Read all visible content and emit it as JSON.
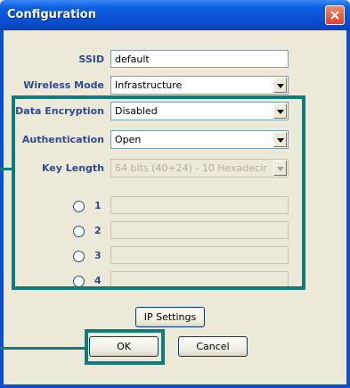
{
  "window": {
    "title": "Configuration"
  },
  "form": {
    "ssid_label": "SSID",
    "ssid_value": "default",
    "wireless_mode_label": "Wireless Mode",
    "wireless_mode_value": "Infrastructure",
    "data_encryption_label": "Data Encryption",
    "data_encryption_value": "Disabled",
    "authentication_label": "Authentication",
    "authentication_value": "Open",
    "key_length_label": "Key Length",
    "key_length_value": "64 bits (40+24) - 10 Hexadecir",
    "keys": [
      {
        "label": "1",
        "value": ""
      },
      {
        "label": "2",
        "value": ""
      },
      {
        "label": "3",
        "value": ""
      },
      {
        "label": "4",
        "value": ""
      }
    ]
  },
  "buttons": {
    "ip_settings": "IP Settings",
    "ok": "OK",
    "cancel": "Cancel"
  },
  "colors": {
    "highlight": "#0e7c7b",
    "label_blue": "#2e4c91"
  }
}
